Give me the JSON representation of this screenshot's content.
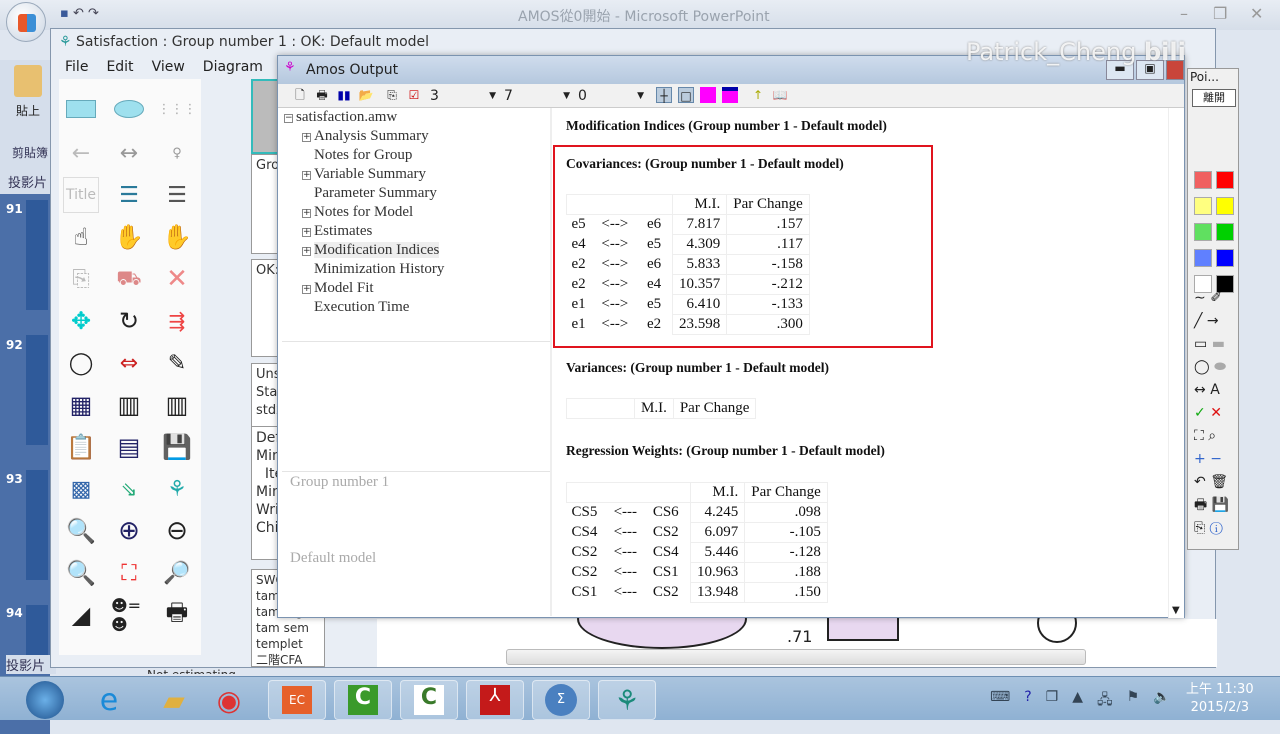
{
  "powerpoint": {
    "title": "AMOS從0開始 - Microsoft PowerPoint",
    "paste_label": "貼上",
    "clipboard_label": "剪貼簿",
    "slides_tab": "投影片",
    "slide_numbers": [
      "91",
      "92",
      "93",
      "94"
    ],
    "footer_tab": "投影片"
  },
  "amos_graphics": {
    "title": "Satisfaction : Group number 1 : OK: Default model",
    "menu": [
      "File",
      "Edit",
      "View",
      "Diagram"
    ],
    "panels": {
      "groups": "Group numb",
      "models": "OK: Default",
      "params": [
        "Unstandardi",
        "Standardize",
        "stdxy3d"
      ],
      "messages": [
        "Default mo",
        "Minimizat",
        "  Iteration",
        "Minimum",
        "Writing ou",
        "Chi-square"
      ],
      "files": [
        "SWC",
        "tam path",
        "tam regressi",
        "tam sem",
        "templet",
        "二階CFA"
      ]
    },
    "title_tool": "Title",
    "diagram_label": ".71",
    "status": "Not estimating ... "
  },
  "amos_output": {
    "title": "Amos Output",
    "toolbar": {
      "combo1": "3",
      "combo2": "7",
      "combo3": "0"
    },
    "tree": {
      "root": "satisfaction.amw",
      "items": [
        {
          "label": "Analysis Summary",
          "expandable": true
        },
        {
          "label": "Notes for Group",
          "expandable": false
        },
        {
          "label": "Variable Summary",
          "expandable": true
        },
        {
          "label": "Parameter Summary",
          "expandable": false
        },
        {
          "label": "Notes for Model",
          "expandable": true
        },
        {
          "label": "Estimates",
          "expandable": true
        },
        {
          "label": "Modification Indices",
          "expandable": true,
          "selected": true
        },
        {
          "label": "Minimization History",
          "expandable": false
        },
        {
          "label": "Model Fit",
          "expandable": true
        },
        {
          "label": "Execution Time",
          "expandable": false
        }
      ],
      "group": "Group number 1",
      "model": "Default model"
    },
    "content": {
      "heading": "Modification Indices (Group number 1 - Default model)",
      "covariances": {
        "title": "Covariances: (Group number 1 - Default model)",
        "headers": [
          "M.I.",
          "Par Change"
        ],
        "rows": [
          [
            "e5",
            "<-->",
            "e6",
            "7.817",
            ".157"
          ],
          [
            "e4",
            "<-->",
            "e5",
            "4.309",
            ".117"
          ],
          [
            "e2",
            "<-->",
            "e6",
            "5.833",
            "-.158"
          ],
          [
            "e2",
            "<-->",
            "e4",
            "10.357",
            "-.212"
          ],
          [
            "e1",
            "<-->",
            "e5",
            "6.410",
            "-.133"
          ],
          [
            "e1",
            "<-->",
            "e2",
            "23.598",
            ".300"
          ]
        ]
      },
      "variances": {
        "title": "Variances: (Group number 1 - Default model)",
        "headers": [
          "M.I.",
          "Par Change"
        ]
      },
      "regression": {
        "title": "Regression Weights: (Group number 1 - Default model)",
        "headers": [
          "M.I.",
          "Par Change"
        ],
        "rows": [
          [
            "CS5",
            "<---",
            "CS6",
            "4.245",
            ".098"
          ],
          [
            "CS4",
            "<---",
            "CS2",
            "6.097",
            "-.105"
          ],
          [
            "CS2",
            "<---",
            "CS4",
            "5.446",
            "-.128"
          ],
          [
            "CS2",
            "<---",
            "CS1",
            "10.963",
            ".188"
          ],
          [
            "CS1",
            "<---",
            "CS2",
            "13.948",
            ".150"
          ]
        ]
      }
    },
    "highlight_color": "#e0141e"
  },
  "pointer_panel": {
    "title": "Poi...",
    "leave_button": "離開",
    "ink_colors": [
      "#f06060",
      "#ff0000",
      "#ffff80",
      "#ffff00",
      "#60e060",
      "#00d000",
      "#6080ff",
      "#0000ff",
      "#ffffff",
      "#000000"
    ]
  },
  "watermark": "Patrick_Cheng",
  "taskbar": {
    "time": "上午 11:30",
    "date": "2015/2/3"
  }
}
